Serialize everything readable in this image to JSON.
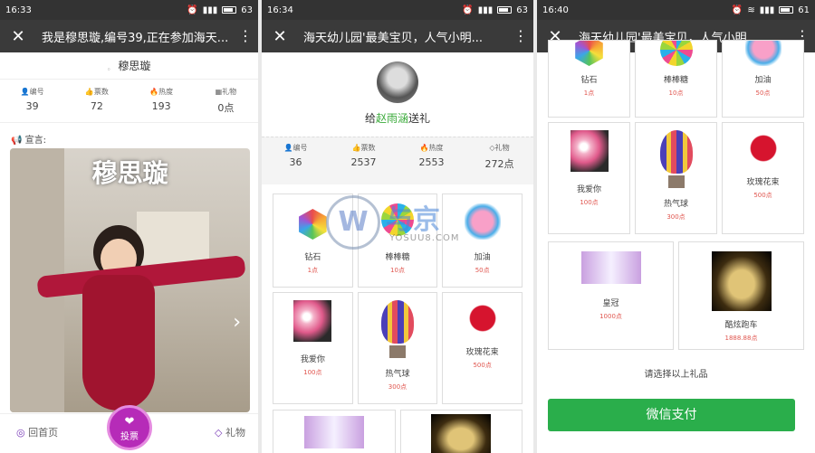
{
  "p1": {
    "time": "16:33",
    "battery": "63",
    "title": "我是穆思璇,编号39,正在参加海天...",
    "name": "穆思璇",
    "stats": [
      {
        "k": "编号",
        "v": "39"
      },
      {
        "k": "票数",
        "v": "72"
      },
      {
        "k": "热度",
        "v": "193"
      },
      {
        "k": "礼物",
        "v": "0点"
      }
    ],
    "declare": "宣言:",
    "photo_caption": "穆思璇",
    "home": "回首页",
    "vote": "投票",
    "gift": "礼物"
  },
  "p2": {
    "time": "16:34",
    "battery": "63",
    "title": "海天幼儿园'最美宝贝，人气小明...",
    "give_prefix": "给",
    "give_name": "赵雨涵",
    "give_suffix": "送礼",
    "stats": [
      {
        "k": "编号",
        "v": "36"
      },
      {
        "k": "票数",
        "v": "2537"
      },
      {
        "k": "热度",
        "v": "2553"
      },
      {
        "k": "礼物",
        "v": "272点"
      }
    ],
    "gifts": [
      {
        "n": "钻石",
        "c": "1点"
      },
      {
        "n": "棒棒糖",
        "c": "10点"
      },
      {
        "n": "加油",
        "c": "50点"
      },
      {
        "n": "我爱你",
        "c": "100点"
      },
      {
        "n": "热气球",
        "c": "300点"
      },
      {
        "n": "玫瑰花束",
        "c": "500点"
      }
    ]
  },
  "p3": {
    "time": "16:40",
    "battery": "61",
    "title": "海天幼儿园'最美宝贝，人气小明...",
    "gifts": [
      {
        "n": "钻石",
        "c": "1点"
      },
      {
        "n": "棒棒糖",
        "c": "10点"
      },
      {
        "n": "加油",
        "c": "50点"
      },
      {
        "n": "我爱你",
        "c": "100点"
      },
      {
        "n": "热气球",
        "c": "300点"
      },
      {
        "n": "玫瑰花束",
        "c": "500点"
      },
      {
        "n": "皇冠",
        "c": "1000点"
      },
      {
        "n": "酷炫跑车",
        "c": "1888.88点"
      }
    ],
    "hint": "请选择以上礼品",
    "pay": "微信支付"
  },
  "watermark": {
    "brand": "与京",
    "url": "YOSUU8.COM"
  }
}
